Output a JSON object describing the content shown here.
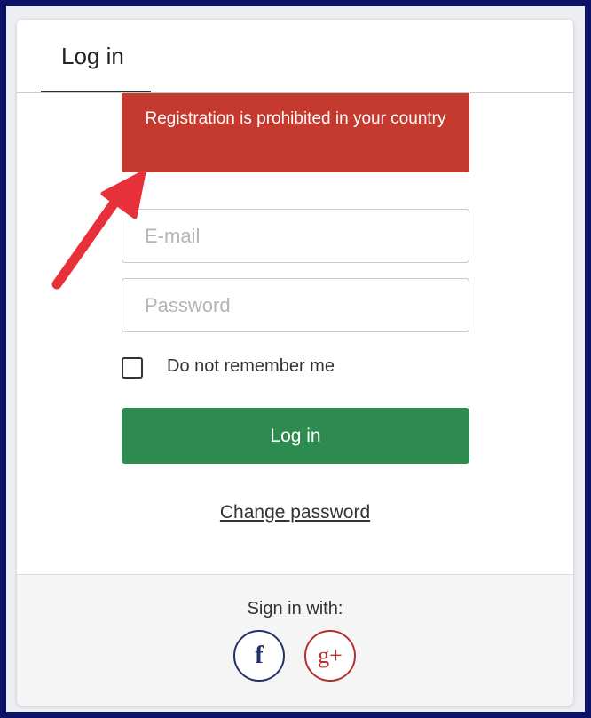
{
  "tabs": {
    "login_label": "Log in"
  },
  "alert": {
    "message": "Registration is prohibited in your country"
  },
  "form": {
    "email_placeholder": "E-mail",
    "password_placeholder": "Password",
    "remember_label": "Do not remember me",
    "remember_checked": false,
    "submit_label": "Log in",
    "change_password_label": "Change password"
  },
  "social": {
    "label": "Sign in with:",
    "facebook_glyph": "f",
    "google_plus_glyph": "g+"
  },
  "colors": {
    "frame_border": "#0c1366",
    "alert_bg": "#c53a2f",
    "login_button_bg": "#2e8b50",
    "facebook": "#24306e",
    "google_plus": "#b52f30",
    "annotation_arrow": "#e8303a"
  }
}
